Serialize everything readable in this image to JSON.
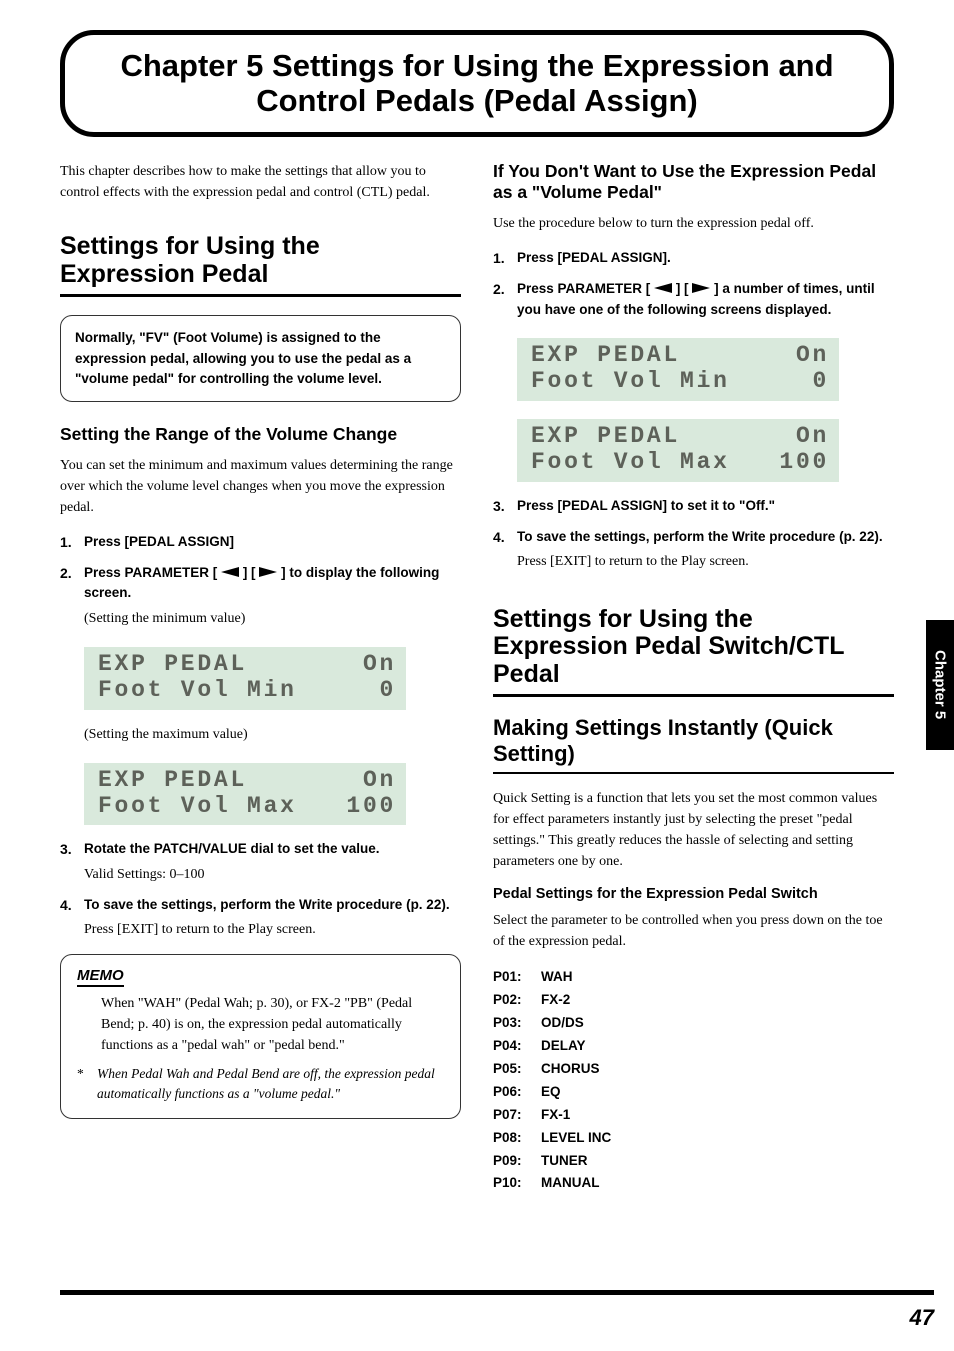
{
  "title": "Chapter 5 Settings for Using the Expression and Control Pedals (Pedal Assign)",
  "intro": "This chapter describes how to make the settings that allow you to control effects with the expression pedal and control (CTL) pedal.",
  "left": {
    "h2": "Settings for Using the Expression Pedal",
    "note": "Normally, \"FV\" (Foot Volume) is assigned to the expression pedal, allowing you to use the pedal as a \"volume pedal\" for controlling the volume level.",
    "h3": "Setting the Range of the Volume Change",
    "body1": "You can set the minimum and maximum values determining the range over which the volume level changes when you move the expression pedal.",
    "steps": [
      {
        "num": "1.",
        "main": "Press [PEDAL ASSIGN]"
      },
      {
        "num": "2.",
        "main_pre": "Press PARAMETER [",
        "main_post": "] to display the following screen.",
        "sub": "(Setting the minimum value)"
      }
    ],
    "lcd_min": {
      "l1": "EXP PEDAL       On",
      "l2": "Foot Vol Min     0"
    },
    "sub_max": "(Setting the maximum value)",
    "lcd_max": {
      "l1": "EXP PEDAL       On",
      "l2": "Foot Vol Max   100"
    },
    "steps2": [
      {
        "num": "3.",
        "main": "Rotate the PATCH/VALUE dial to set the value.",
        "sub": "Valid Settings: 0–100"
      },
      {
        "num": "4.",
        "main": "To save the settings, perform the Write procedure (p. 22).",
        "sub": "Press [EXIT] to return to the Play screen."
      }
    ],
    "memo_label": "MEMO",
    "memo_body": "When \"WAH\" (Pedal Wah; p. 30), or FX-2 \"PB\" (Pedal Bend; p. 40) is on, the expression pedal automatically functions as a \"pedal wah\" or \"pedal bend.\"",
    "memo_note": "When Pedal Wah and Pedal Bend are off, the expression pedal automatically functions as a \"volume pedal.\""
  },
  "right": {
    "h3a": "If You Don't Want to Use the Expression Pedal as a \"Volume Pedal\"",
    "body_a": "Use the procedure below to turn the expression pedal off.",
    "steps_a": [
      {
        "num": "1.",
        "main": "Press [PEDAL ASSIGN]."
      },
      {
        "num": "2.",
        "main_pre": "Press PARAMETER [",
        "main_post": "] a number of times, until you have one of the following screens displayed."
      }
    ],
    "lcd_min": {
      "l1": "EXP PEDAL       On",
      "l2": "Foot Vol Min     0"
    },
    "lcd_max": {
      "l1": "EXP PEDAL       On",
      "l2": "Foot Vol Max   100"
    },
    "steps_b": [
      {
        "num": "3.",
        "main": "Press [PEDAL ASSIGN] to set it to \"Off.\""
      },
      {
        "num": "4.",
        "main": "To save the settings, perform the Write procedure (p. 22).",
        "sub": "Press [EXIT] to return to the Play screen."
      }
    ],
    "h2": "Settings for Using the Expression Pedal Switch/CTL Pedal",
    "h3b": "Making Settings Instantly (Quick Setting)",
    "body_b": "Quick Setting is a function that lets you set the most common values for effect parameters instantly just by selecting the preset \"pedal settings.\" This greatly reduces the hassle of selecting and setting parameters one by one.",
    "h4": "Pedal Settings for the Expression Pedal Switch",
    "body_c": "Select the parameter to be controlled when you press down on the toe of the expression pedal.",
    "pedals": [
      {
        "k": "P01:",
        "v": "WAH"
      },
      {
        "k": "P02:",
        "v": "FX-2"
      },
      {
        "k": "P03:",
        "v": "OD/DS"
      },
      {
        "k": "P04:",
        "v": "DELAY"
      },
      {
        "k": "P05:",
        "v": "CHORUS"
      },
      {
        "k": "P06:",
        "v": "EQ"
      },
      {
        "k": "P07:",
        "v": "FX-1"
      },
      {
        "k": "P08:",
        "v": "LEVEL INC"
      },
      {
        "k": "P09:",
        "v": "TUNER"
      },
      {
        "k": "P10:",
        "v": "MANUAL"
      }
    ]
  },
  "side_tab": "Chapter 5",
  "page_num": "47"
}
